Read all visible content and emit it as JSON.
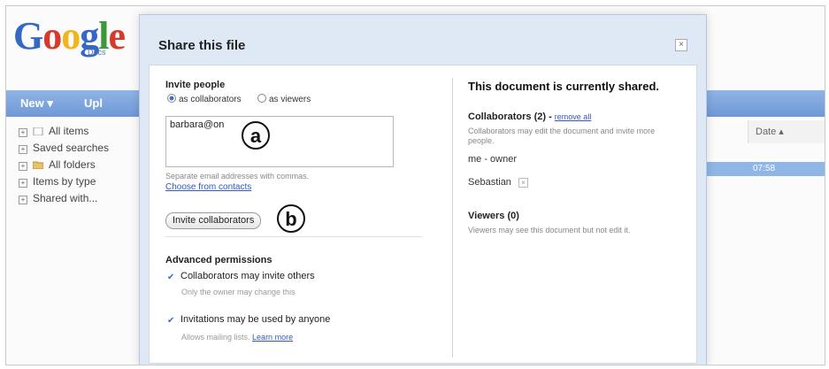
{
  "background": {
    "logo": {
      "letters": [
        "G",
        "o",
        "o",
        "g",
        "l",
        "e"
      ],
      "sub": "Docs"
    },
    "toolbar": {
      "new_label": "New ▾",
      "upload_label": "Upl"
    },
    "sidebar": [
      {
        "label": "All items"
      },
      {
        "label": "Saved searches"
      },
      {
        "label": "All folders"
      },
      {
        "label": "Items by type"
      },
      {
        "label": "Shared with..."
      }
    ],
    "date_column": "Date ▴",
    "selected_time": "07:58"
  },
  "dialog": {
    "title": "Share this file",
    "close_icon": "×",
    "left": {
      "invite_heading": "Invite people",
      "radio_collaborators": "as collaborators",
      "radio_viewers": "as viewers",
      "email_value": "barbara@on",
      "hint": "Separate email addresses with commas.",
      "choose_link": "Choose from contacts",
      "invite_button": "Invite collaborators",
      "advanced_heading": "Advanced permissions",
      "opt1_label": "Collaborators may invite others",
      "opt1_sub": "Only the owner may change this",
      "opt2_label": "Invitations may be used by anyone",
      "opt2_sub": "Allows mailing lists.",
      "learn_more": "Learn more"
    },
    "right": {
      "title": "This document is currently shared.",
      "collab_heading": "Collaborators (2) - ",
      "remove_all": "remove all",
      "collab_desc": "Collaborators may edit the document and invite more people.",
      "collaborators": [
        "me - owner",
        "Sebastian"
      ],
      "viewers_heading": "Viewers (0)",
      "viewers_desc": "Viewers may see this document but not edit it."
    }
  },
  "annotations": {
    "a": "a",
    "b": "b"
  }
}
